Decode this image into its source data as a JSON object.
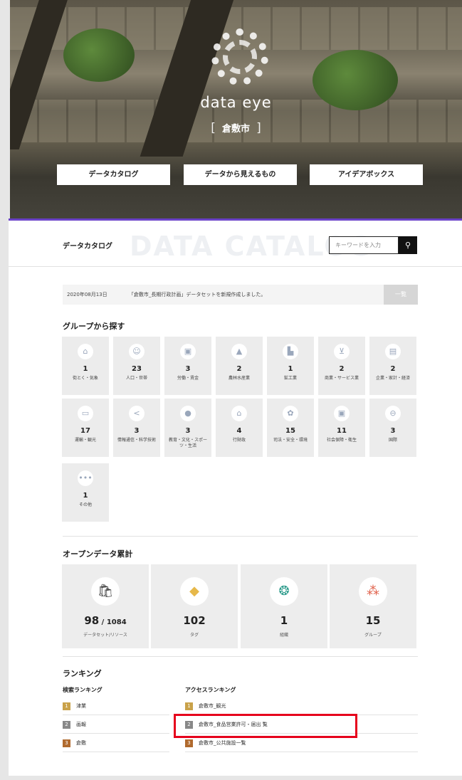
{
  "hero": {
    "brand": "data eye",
    "city": "倉敷市",
    "bracket_left": "[",
    "bracket_right": "]",
    "nav": [
      "データカタログ",
      "データから見えるもの",
      "アイデアボックス"
    ]
  },
  "catalog": {
    "title": "データカタログ",
    "watermark": "DATA CATALOG",
    "search_placeholder": "キーワードを入力",
    "search_icon": "search-icon"
  },
  "news": {
    "date": "2020年08月13日",
    "text": "「倉敷市_長期行政計画」データセットを新規作成しました。",
    "more_label": "一覧"
  },
  "groups": {
    "title": "グループから探す",
    "items": [
      {
        "icon": "house-icon",
        "count": "1",
        "label": "街とく・気象"
      },
      {
        "icon": "people-icon",
        "count": "23",
        "label": "人口・世帯"
      },
      {
        "icon": "briefcase-icon",
        "count": "3",
        "label": "労働・賃金"
      },
      {
        "icon": "tree-icon",
        "count": "2",
        "label": "農林水産業"
      },
      {
        "icon": "factory-icon",
        "count": "1",
        "label": "鉱工業"
      },
      {
        "icon": "cart-icon",
        "count": "2",
        "label": "商業・サービス業"
      },
      {
        "icon": "calculator-icon",
        "count": "2",
        "label": "企業・家計・経済"
      },
      {
        "icon": "bus-icon",
        "count": "17",
        "label": "運輸・観光"
      },
      {
        "icon": "share-icon",
        "count": "3",
        "label": "情報通信・科学技術"
      },
      {
        "icon": "circle-icon",
        "count": "3",
        "label": "教育・文化・スポーツ・生活"
      },
      {
        "icon": "building-icon",
        "count": "4",
        "label": "行財政"
      },
      {
        "icon": "shield-icon",
        "count": "15",
        "label": "司法・安全・環境"
      },
      {
        "icon": "medical-icon",
        "count": "11",
        "label": "社会保障・衛生"
      },
      {
        "icon": "globe-icon",
        "count": "3",
        "label": "国際"
      },
      {
        "icon": "more-icon",
        "count": "1",
        "label": "その他"
      }
    ]
  },
  "stats": {
    "title": "オープンデータ累計",
    "items": [
      {
        "icon": "bag-icon",
        "num": "98",
        "sub": " / 1084",
        "label": "データセット/リソース"
      },
      {
        "icon": "tag-icon",
        "num": "102",
        "sub": "",
        "label": "タグ"
      },
      {
        "icon": "org-icon",
        "num": "1",
        "sub": "",
        "label": "組織"
      },
      {
        "icon": "group-icon",
        "num": "15",
        "sub": "",
        "label": "グループ"
      }
    ]
  },
  "ranking": {
    "title": "ランキング",
    "search_title": "検索ランキング",
    "access_title": "アクセスランキング",
    "search_items": [
      {
        "rank": "1",
        "text": "津業"
      },
      {
        "rank": "2",
        "text": "画報"
      },
      {
        "rank": "3",
        "text": "倉敷"
      }
    ],
    "access_items": [
      {
        "rank": "1",
        "text": "倉敷市_観光"
      },
      {
        "rank": "2",
        "text": "倉敷市_食品営業許可・届出 覧"
      },
      {
        "rank": "3",
        "text": "倉敷市_公共施設一覧"
      }
    ]
  }
}
